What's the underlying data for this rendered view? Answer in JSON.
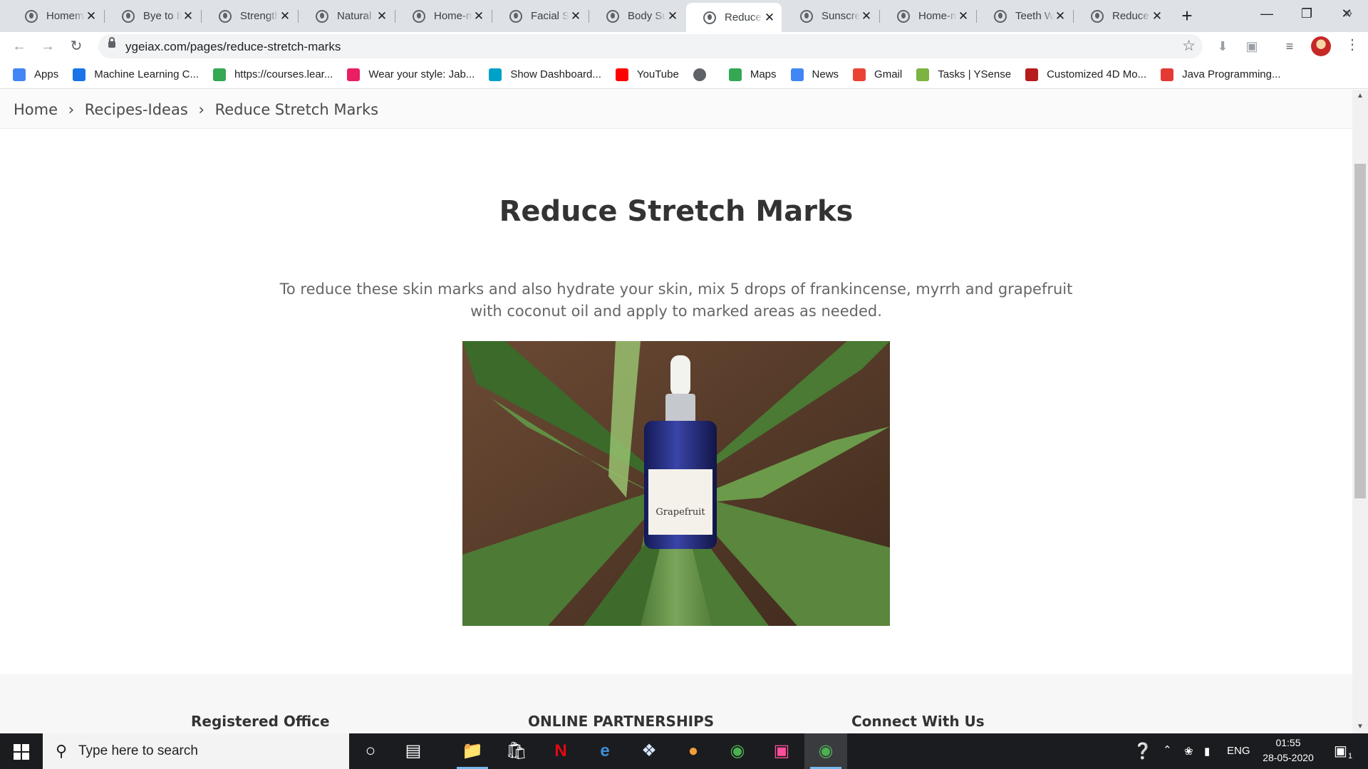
{
  "browser": {
    "tabs": [
      {
        "title": "Homemade"
      },
      {
        "title": "Bye to Itchy"
      },
      {
        "title": "Strengthen"
      },
      {
        "title": "Natural Face"
      },
      {
        "title": "Home-made"
      },
      {
        "title": "Facial Scrub"
      },
      {
        "title": "Body Sugar"
      },
      {
        "title": "Reduce Stretch"
      },
      {
        "title": "Sunscreen"
      },
      {
        "title": "Home-made"
      },
      {
        "title": "Teeth Whitening"
      },
      {
        "title": "Reduce Stretch"
      }
    ],
    "active_tab_index": 7,
    "url": "ygeiax.com/pages/reduce-stretch-marks",
    "bookmarks": [
      {
        "label": "Apps",
        "icon": "apps-grid-icon",
        "color": "#4285f4"
      },
      {
        "label": "Machine Learning C...",
        "icon": "ml-icon",
        "color": "#1a73e8"
      },
      {
        "label": "https://courses.lear...",
        "icon": "courses-icon",
        "color": "#34a853"
      },
      {
        "label": "Wear your style: Jab...",
        "icon": "myntra-icon",
        "color": "#e91e63"
      },
      {
        "label": "Show Dashboard...",
        "icon": "dashboard-icon",
        "color": "#00a1c9"
      },
      {
        "label": "YouTube",
        "icon": "youtube-icon",
        "color": "#ff0000"
      },
      {
        "label": "",
        "icon": "globe-icon",
        "color": "#5f6368"
      },
      {
        "label": "Maps",
        "icon": "maps-icon",
        "color": "#34a853"
      },
      {
        "label": "News",
        "icon": "news-icon",
        "color": "#4285f4"
      },
      {
        "label": "Gmail",
        "icon": "gmail-icon",
        "color": "#ea4335"
      },
      {
        "label": "Tasks | YSense",
        "icon": "ysense-icon",
        "color": "#7cb342"
      },
      {
        "label": "Customized 4D Mo...",
        "icon": "4d-icon",
        "color": "#b71c1c"
      },
      {
        "label": "Java Programming...",
        "icon": "java-icon",
        "color": "#e53935"
      }
    ]
  },
  "page": {
    "breadcrumbs": [
      "Home",
      "›",
      "Recipes-Ideas",
      "›",
      "Reduce Stretch Marks"
    ],
    "title": "Reduce Stretch Marks",
    "description": "To reduce these skin marks and also hydrate your skin, mix 5 drops of frankincense, myrrh and grapefruit with coconut oil and apply to marked areas as needed.",
    "photo": {
      "bottle_label": "Grapefruit"
    },
    "footer": {
      "col1": "Registered Office",
      "col2": "ONLINE PARTNERSHIPS",
      "col3": "Connect With Us"
    }
  },
  "taskbar": {
    "search_placeholder": "Type here to search",
    "language": "ENG",
    "time": "01:55",
    "date": "28-05-2020",
    "notifications": "1"
  }
}
